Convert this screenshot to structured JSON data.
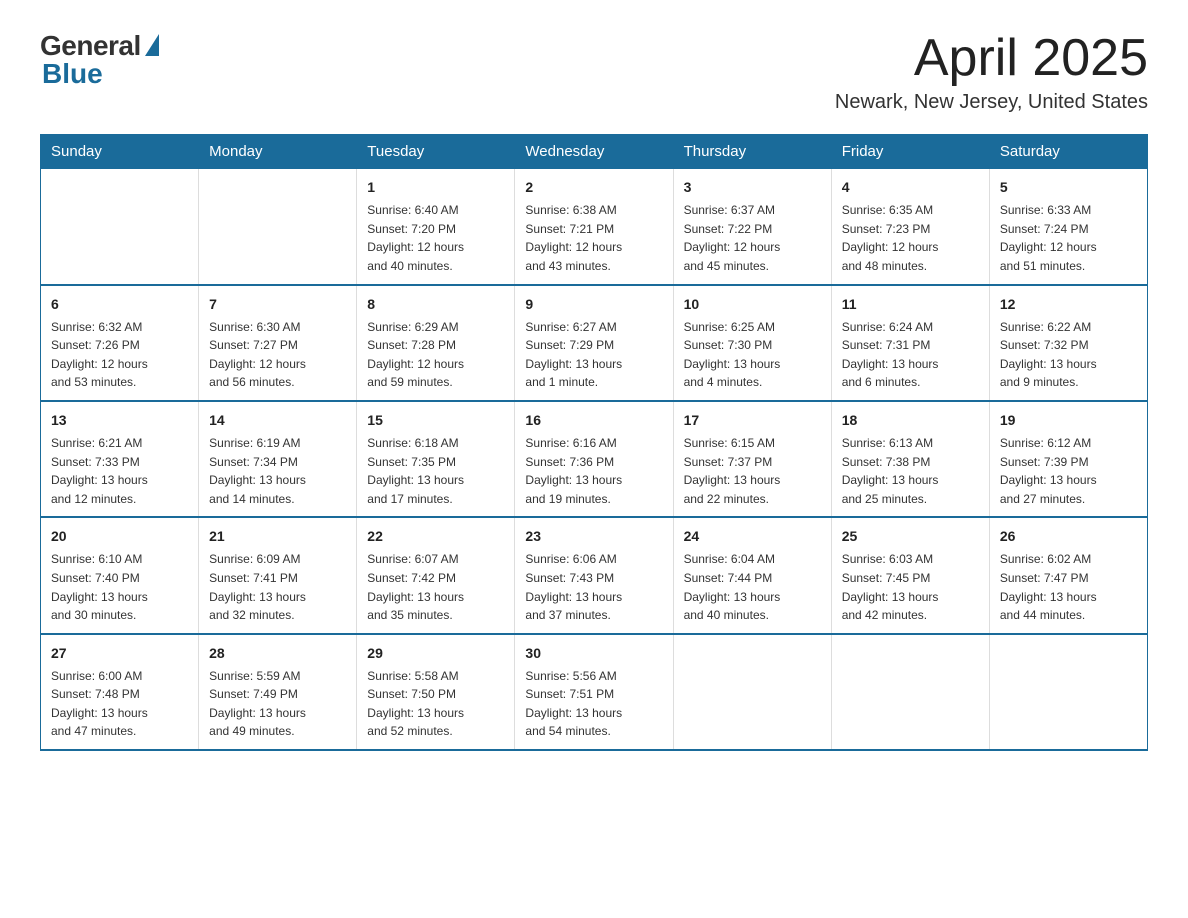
{
  "logo": {
    "general": "General",
    "blue": "Blue"
  },
  "title": "April 2025",
  "location": "Newark, New Jersey, United States",
  "days_of_week": [
    "Sunday",
    "Monday",
    "Tuesday",
    "Wednesday",
    "Thursday",
    "Friday",
    "Saturday"
  ],
  "weeks": [
    [
      {
        "day": "",
        "info": ""
      },
      {
        "day": "",
        "info": ""
      },
      {
        "day": "1",
        "info": "Sunrise: 6:40 AM\nSunset: 7:20 PM\nDaylight: 12 hours\nand 40 minutes."
      },
      {
        "day": "2",
        "info": "Sunrise: 6:38 AM\nSunset: 7:21 PM\nDaylight: 12 hours\nand 43 minutes."
      },
      {
        "day": "3",
        "info": "Sunrise: 6:37 AM\nSunset: 7:22 PM\nDaylight: 12 hours\nand 45 minutes."
      },
      {
        "day": "4",
        "info": "Sunrise: 6:35 AM\nSunset: 7:23 PM\nDaylight: 12 hours\nand 48 minutes."
      },
      {
        "day": "5",
        "info": "Sunrise: 6:33 AM\nSunset: 7:24 PM\nDaylight: 12 hours\nand 51 minutes."
      }
    ],
    [
      {
        "day": "6",
        "info": "Sunrise: 6:32 AM\nSunset: 7:26 PM\nDaylight: 12 hours\nand 53 minutes."
      },
      {
        "day": "7",
        "info": "Sunrise: 6:30 AM\nSunset: 7:27 PM\nDaylight: 12 hours\nand 56 minutes."
      },
      {
        "day": "8",
        "info": "Sunrise: 6:29 AM\nSunset: 7:28 PM\nDaylight: 12 hours\nand 59 minutes."
      },
      {
        "day": "9",
        "info": "Sunrise: 6:27 AM\nSunset: 7:29 PM\nDaylight: 13 hours\nand 1 minute."
      },
      {
        "day": "10",
        "info": "Sunrise: 6:25 AM\nSunset: 7:30 PM\nDaylight: 13 hours\nand 4 minutes."
      },
      {
        "day": "11",
        "info": "Sunrise: 6:24 AM\nSunset: 7:31 PM\nDaylight: 13 hours\nand 6 minutes."
      },
      {
        "day": "12",
        "info": "Sunrise: 6:22 AM\nSunset: 7:32 PM\nDaylight: 13 hours\nand 9 minutes."
      }
    ],
    [
      {
        "day": "13",
        "info": "Sunrise: 6:21 AM\nSunset: 7:33 PM\nDaylight: 13 hours\nand 12 minutes."
      },
      {
        "day": "14",
        "info": "Sunrise: 6:19 AM\nSunset: 7:34 PM\nDaylight: 13 hours\nand 14 minutes."
      },
      {
        "day": "15",
        "info": "Sunrise: 6:18 AM\nSunset: 7:35 PM\nDaylight: 13 hours\nand 17 minutes."
      },
      {
        "day": "16",
        "info": "Sunrise: 6:16 AM\nSunset: 7:36 PM\nDaylight: 13 hours\nand 19 minutes."
      },
      {
        "day": "17",
        "info": "Sunrise: 6:15 AM\nSunset: 7:37 PM\nDaylight: 13 hours\nand 22 minutes."
      },
      {
        "day": "18",
        "info": "Sunrise: 6:13 AM\nSunset: 7:38 PM\nDaylight: 13 hours\nand 25 minutes."
      },
      {
        "day": "19",
        "info": "Sunrise: 6:12 AM\nSunset: 7:39 PM\nDaylight: 13 hours\nand 27 minutes."
      }
    ],
    [
      {
        "day": "20",
        "info": "Sunrise: 6:10 AM\nSunset: 7:40 PM\nDaylight: 13 hours\nand 30 minutes."
      },
      {
        "day": "21",
        "info": "Sunrise: 6:09 AM\nSunset: 7:41 PM\nDaylight: 13 hours\nand 32 minutes."
      },
      {
        "day": "22",
        "info": "Sunrise: 6:07 AM\nSunset: 7:42 PM\nDaylight: 13 hours\nand 35 minutes."
      },
      {
        "day": "23",
        "info": "Sunrise: 6:06 AM\nSunset: 7:43 PM\nDaylight: 13 hours\nand 37 minutes."
      },
      {
        "day": "24",
        "info": "Sunrise: 6:04 AM\nSunset: 7:44 PM\nDaylight: 13 hours\nand 40 minutes."
      },
      {
        "day": "25",
        "info": "Sunrise: 6:03 AM\nSunset: 7:45 PM\nDaylight: 13 hours\nand 42 minutes."
      },
      {
        "day": "26",
        "info": "Sunrise: 6:02 AM\nSunset: 7:47 PM\nDaylight: 13 hours\nand 44 minutes."
      }
    ],
    [
      {
        "day": "27",
        "info": "Sunrise: 6:00 AM\nSunset: 7:48 PM\nDaylight: 13 hours\nand 47 minutes."
      },
      {
        "day": "28",
        "info": "Sunrise: 5:59 AM\nSunset: 7:49 PM\nDaylight: 13 hours\nand 49 minutes."
      },
      {
        "day": "29",
        "info": "Sunrise: 5:58 AM\nSunset: 7:50 PM\nDaylight: 13 hours\nand 52 minutes."
      },
      {
        "day": "30",
        "info": "Sunrise: 5:56 AM\nSunset: 7:51 PM\nDaylight: 13 hours\nand 54 minutes."
      },
      {
        "day": "",
        "info": ""
      },
      {
        "day": "",
        "info": ""
      },
      {
        "day": "",
        "info": ""
      }
    ]
  ]
}
